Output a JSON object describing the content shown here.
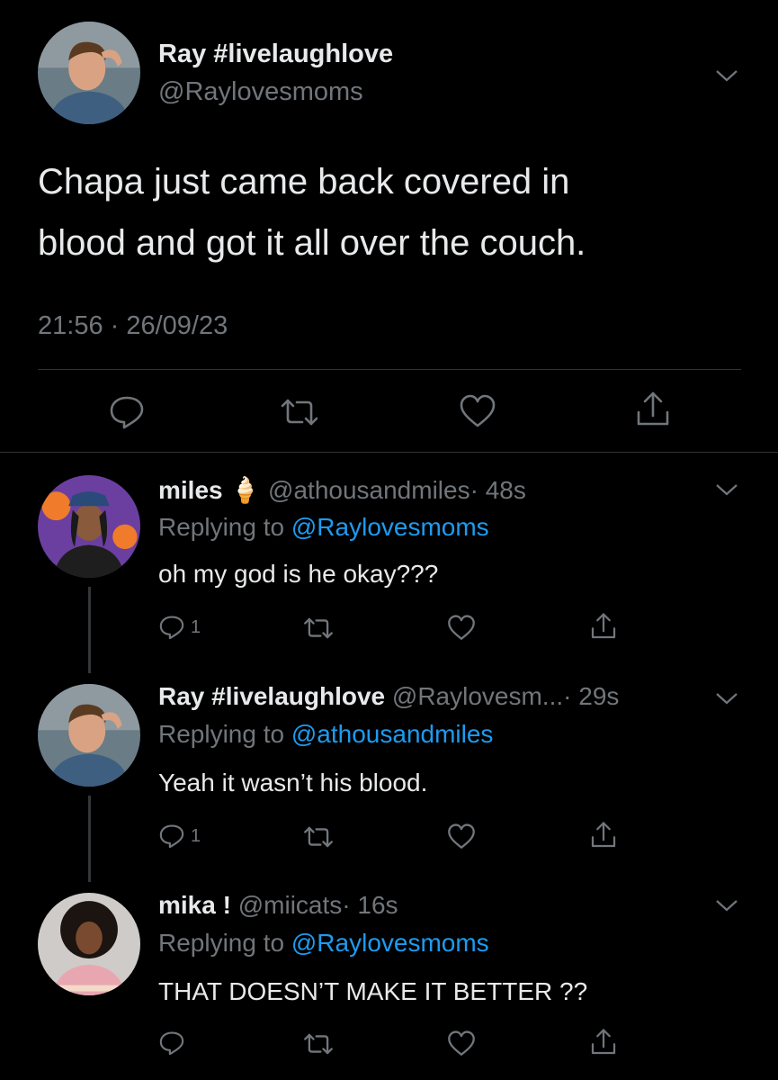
{
  "main_tweet": {
    "display_name": "Ray #livelaughlove",
    "handle": "@Raylovesmoms",
    "text_line1": "Chapa just came back covered in",
    "text_line2": "blood and got it all over the couch.",
    "timestamp": "21:56 · 26/09/23"
  },
  "replies": [
    {
      "display_name": "miles",
      "emoji": "🍦",
      "handle": "@athousandmiles",
      "time": "· 48s",
      "replying_prefix": "Replying to",
      "replying_to": "@Raylovesmoms",
      "text": "oh my god is he okay???",
      "reply_count": "1"
    },
    {
      "display_name": "Ray #livelaughlove",
      "handle": "@Raylovesm...",
      "time": "· 29s",
      "replying_prefix": "Replying to",
      "replying_to": "@athousandmiles",
      "text": "Yeah it wasn’t his blood.",
      "reply_count": "1"
    },
    {
      "display_name": "mika !",
      "handle": "@miicats",
      "time": "· 16s",
      "replying_prefix": "Replying to",
      "replying_to": "@Raylovesmoms",
      "text": "THAT DOESN’T MAKE IT BETTER ??",
      "reply_count": ""
    }
  ],
  "colors": {
    "background": "#000000",
    "text": "#e7e9ea",
    "secondary": "#71767b",
    "link": "#1d9bf0",
    "divider": "#2f3336"
  },
  "icons": [
    "reply-icon",
    "retweet-icon",
    "like-icon",
    "share-icon",
    "chevron-down-icon"
  ]
}
